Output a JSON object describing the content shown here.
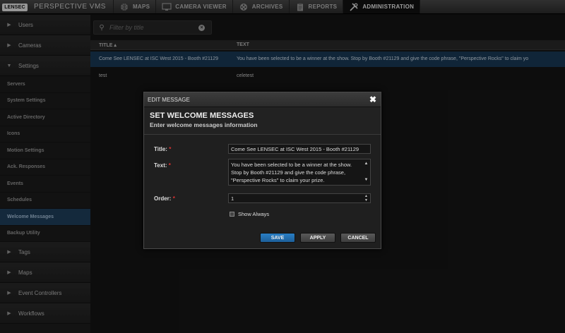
{
  "app": {
    "logo_text": "LENSEC",
    "brand": "PERSPECTIVE VMS"
  },
  "nav": [
    {
      "label": "MAPS",
      "icon": "globe-icon"
    },
    {
      "label": "CAMERA VIEWER",
      "icon": "monitor-icon"
    },
    {
      "label": "ARCHIVES",
      "icon": "film-reel-icon"
    },
    {
      "label": "REPORTS",
      "icon": "clipboard-icon"
    },
    {
      "label": "ADMINISTRATION",
      "icon": "tools-icon",
      "active": true
    }
  ],
  "sidebar": {
    "groups_top": [
      {
        "label": "Users",
        "expanded": false
      },
      {
        "label": "Cameras",
        "expanded": false
      },
      {
        "label": "Settings",
        "expanded": true
      }
    ],
    "settings_items": [
      {
        "label": "Servers"
      },
      {
        "label": "System Settings"
      },
      {
        "label": "Active Directory"
      },
      {
        "label": "Icons"
      },
      {
        "label": "Motion Settings"
      },
      {
        "label": "Ack. Responses"
      },
      {
        "label": "Events"
      },
      {
        "label": "Schedules"
      },
      {
        "label": "Welcome Messages",
        "active": true
      },
      {
        "label": "Backup Utility"
      }
    ],
    "groups_bottom": [
      {
        "label": "Tags"
      },
      {
        "label": "Maps"
      },
      {
        "label": "Event Controllers"
      },
      {
        "label": "Workflows"
      }
    ]
  },
  "filter": {
    "placeholder": "Filter by title",
    "value": ""
  },
  "table": {
    "columns": [
      "TITLE ▴",
      "TEXT"
    ],
    "rows": [
      {
        "title": "Come See LENSEC at ISC West 2015 - Booth #21129",
        "text": "You have been selected to be a winner at the show.  Stop by Booth #21129 and give the code phrase, \"Perspective Rocks\" to claim yo",
        "selected": true
      },
      {
        "title": "test",
        "text": "celetest",
        "selected": false
      }
    ]
  },
  "modal": {
    "window_title": "EDIT MESSAGE",
    "heading": "SET WELCOME MESSAGES",
    "subheading": "Enter welcome messages information",
    "title_label": "Title:",
    "title_value": "Come See LENSEC at ISC West 2015 - Booth #21129",
    "text_label": "Text:",
    "text_value": "You have been selected to be a winner at the show.  Stop by Booth #21129 and give the code phrase, \"Perspective Rocks\" to claim your prize.",
    "order_label": "Order:",
    "order_value": "1",
    "required_mark": "*",
    "show_always_label": "Show Always",
    "show_always_checked": false,
    "buttons": {
      "save": "SAVE",
      "apply": "APPLY",
      "cancel": "CANCEL"
    }
  },
  "colors": {
    "accent": "#2a7fc6",
    "selected_row": "#1a3a56",
    "required": "#dd3333"
  }
}
